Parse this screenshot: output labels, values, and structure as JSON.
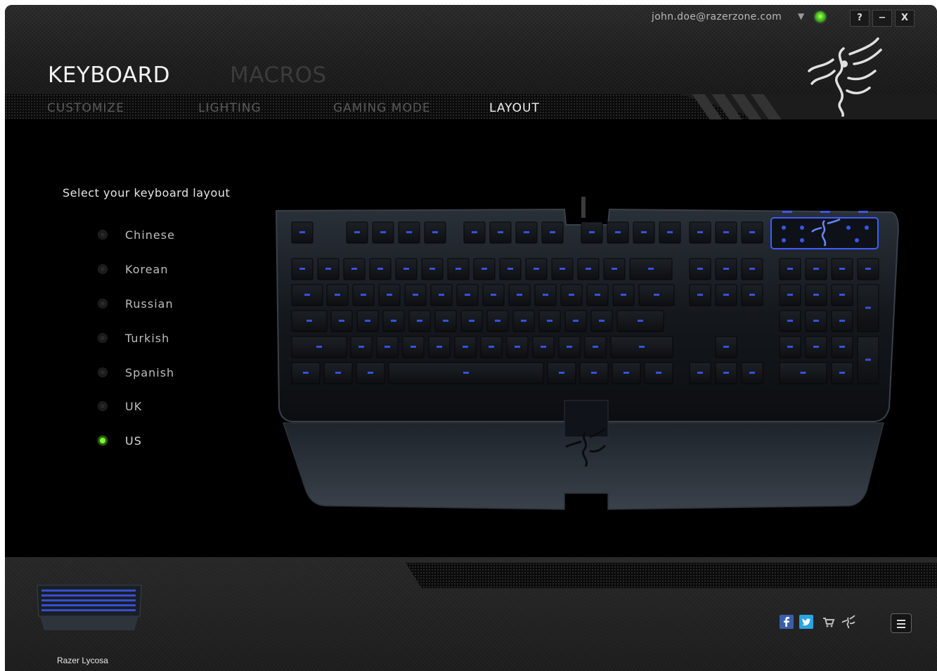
{
  "header": {
    "user_email": "john.doe@razerzone.com",
    "help_label": "?",
    "minimize_label": "−",
    "close_label": "X",
    "main_tabs": [
      {
        "label": "KEYBOARD",
        "active": true
      },
      {
        "label": "MACROS",
        "active": false
      }
    ],
    "sub_tabs": [
      {
        "label": "CUSTOMIZE",
        "active": false
      },
      {
        "label": "LIGHTING",
        "active": false
      },
      {
        "label": "GAMING MODE",
        "active": false
      },
      {
        "label": "LAYOUT",
        "active": true
      }
    ]
  },
  "layout": {
    "prompt": "Select your keyboard layout",
    "options": [
      {
        "label": "Chinese",
        "selected": false
      },
      {
        "label": "Korean",
        "selected": false
      },
      {
        "label": "Russian",
        "selected": false
      },
      {
        "label": "Turkish",
        "selected": false
      },
      {
        "label": "Spanish",
        "selected": false
      },
      {
        "label": "UK",
        "selected": false
      },
      {
        "label": "US",
        "selected": true
      }
    ],
    "selected_value": "US"
  },
  "footer": {
    "device_name": "Razer Lycosa",
    "social": [
      "facebook-icon",
      "twitter-icon",
      "store-cart-icon",
      "razer-insider-icon"
    ]
  },
  "colors": {
    "accent_green": "#6cff1f",
    "key_glow_blue": "#3d5cff",
    "bg": "#0b0b0b"
  }
}
